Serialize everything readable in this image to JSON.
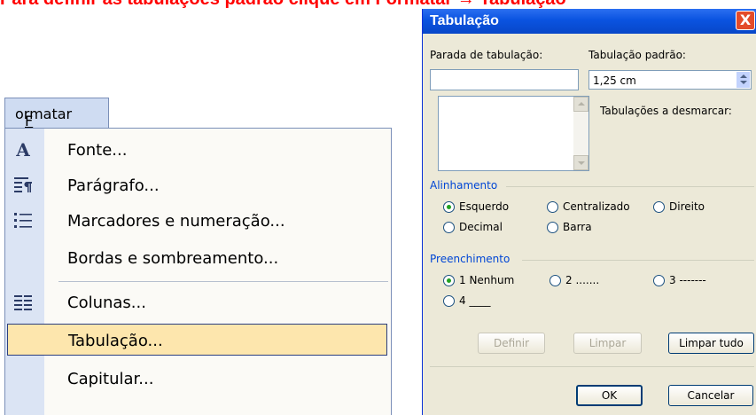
{
  "header_text": "Para definir as tabulações padrão clique em Formatar → Tabulação",
  "menu": {
    "title": "Formatar",
    "items": [
      {
        "label": "Fonte...",
        "icon": "font-A-icon"
      },
      {
        "label": "Parágrafo...",
        "icon": "paragraph-icon"
      },
      {
        "label": "Marcadores e numeração...",
        "icon": "bullets-icon"
      },
      {
        "label": "Bordas e sombreamento...",
        "icon": ""
      },
      {
        "label": "Colunas...",
        "icon": "columns-icon"
      },
      {
        "label": "Tabulação...",
        "icon": "",
        "highlighted": true
      },
      {
        "label": "Capitular...",
        "icon": ""
      }
    ]
  },
  "dialog": {
    "title": "Tabulação",
    "close_label": "X",
    "tab_stop_label": "Parada de tabulação:",
    "tab_stop_value": "",
    "default_tab_label": "Tabulação padrão:",
    "default_tab_value": "1,25 cm",
    "clear_list_label": "Tabulações a desmarcar:",
    "alignment": {
      "title": "Alinhamento",
      "options": [
        "Esquerdo",
        "Centralizado",
        "Direito",
        "Decimal",
        "Barra"
      ],
      "selected": "Esquerdo"
    },
    "leader": {
      "title": "Preenchimento",
      "options": [
        "1 Nenhum",
        "2 .......",
        "3 -------",
        "4 ____"
      ],
      "selected": "1 Nenhum"
    },
    "buttons": {
      "set": "Definir",
      "clear": "Limpar",
      "clear_all": "Limpar tudo",
      "ok": "OK",
      "cancel": "Cancelar"
    }
  },
  "colors": {
    "header_red": "#ff0000",
    "titlebar_blue": "#0a53e0",
    "highlight": "#fde6ad",
    "group_title": "#0046d5"
  }
}
